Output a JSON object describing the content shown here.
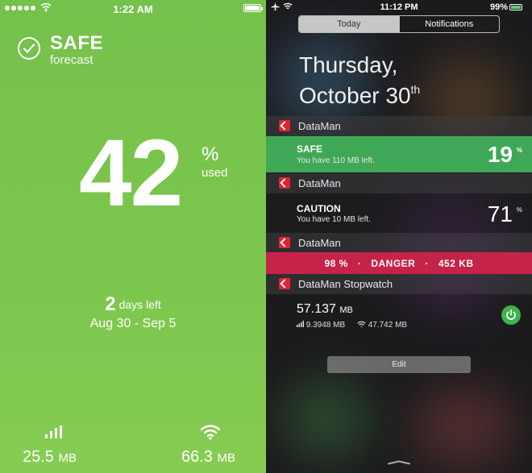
{
  "left": {
    "status_time": "1:22 AM",
    "status_title": "SAFE",
    "status_subtitle": "forecast",
    "usage_value": "42",
    "usage_unit": "%",
    "usage_label": "used",
    "days_number": "2",
    "days_label": "days left",
    "date_range": "Aug 30 - Sep 5",
    "cellular_amount": "25.5",
    "cellular_unit": "MB",
    "wifi_amount": "66.3",
    "wifi_unit": "MB",
    "accent": "#7cc64e"
  },
  "right": {
    "status_time": "11:12 PM",
    "battery_pct": "99%",
    "tabs": [
      "Today",
      "Notifications"
    ],
    "date_line1": "Thursday,",
    "date_line2": "October 30",
    "date_suffix": "th",
    "widgets": {
      "safe": {
        "app": "DataMan",
        "title": "SAFE",
        "subtitle": "You have 110 MB left.",
        "value": "19",
        "unit": "%"
      },
      "caution": {
        "app": "DataMan",
        "title": "CAUTION",
        "subtitle": "You have 10 MB left.",
        "value": "71",
        "unit": "%"
      },
      "danger": {
        "app": "DataMan",
        "pct": "98 %",
        "label": "DANGER",
        "amount": "452 KB",
        "sep": "·"
      },
      "stopwatch": {
        "app": "DataMan Stopwatch",
        "total": "57.137",
        "total_unit": "MB",
        "cellular": "9.3948 MB",
        "wifi": "47.742 MB"
      }
    },
    "edit_label": "Edit",
    "colors": {
      "safe": "#3fa857",
      "danger": "#c5234a",
      "power": "#3cb44a",
      "logo": "#e0242f"
    }
  }
}
